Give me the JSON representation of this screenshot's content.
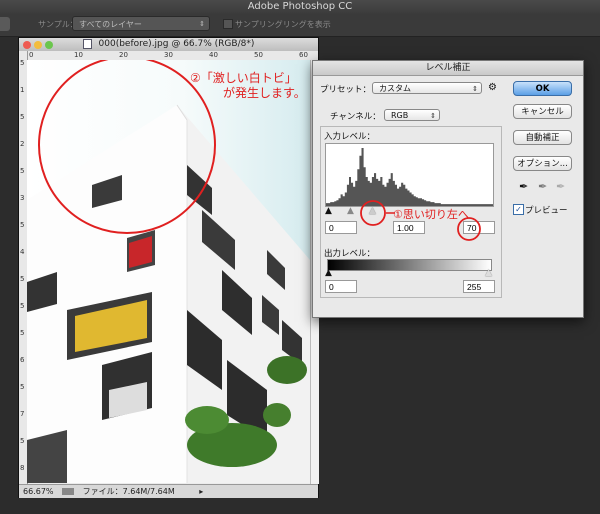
{
  "app": {
    "title": "Adobe Photoshop CC"
  },
  "options_bar": {
    "sample_label": "サンプル：",
    "layer_select": "すべてのレイヤー",
    "sampling_ring_label": "サンプリングリングを表示"
  },
  "document": {
    "title": "000(before).jpg @ 66.7% (RGB/8*)",
    "ruler_top": [
      "0",
      "10",
      "20",
      "30",
      "40",
      "50",
      "60"
    ],
    "ruler_left": [
      "5",
      "1",
      "5",
      "2",
      "5",
      "3",
      "5",
      "4",
      "5",
      "5",
      "5",
      "6",
      "5",
      "7",
      "5",
      "8"
    ],
    "zoom": "66.67%",
    "file_info": "ファイル：7.64M/7.64M"
  },
  "levels": {
    "title": "レベル補正",
    "preset_label": "プリセット：",
    "preset_value": "カスタム",
    "channel_label": "チャンネル：",
    "channel_value": "RGB",
    "input_label": "入力レベル：",
    "input_black": "0",
    "input_gamma": "1.00",
    "input_white": "70",
    "output_label": "出力レベル：",
    "output_black": "0",
    "output_white": "255",
    "ok": "OK",
    "cancel": "キャンセル",
    "auto": "自動補正",
    "options": "オプション...",
    "preview_label": "プレビュー",
    "preview_checked": true,
    "histogram": [
      3,
      3,
      4,
      4,
      5,
      6,
      8,
      12,
      10,
      14,
      22,
      30,
      24,
      20,
      26,
      38,
      52,
      60,
      40,
      30,
      26,
      24,
      30,
      34,
      28,
      26,
      30,
      22,
      20,
      24,
      28,
      34,
      26,
      22,
      18,
      20,
      24,
      22,
      18,
      16,
      14,
      12,
      10,
      9,
      8,
      8,
      7,
      6,
      5,
      5,
      4,
      4,
      3,
      3,
      3,
      2,
      2,
      2,
      2,
      2,
      2,
      2,
      2,
      2,
      2,
      2,
      2,
      2,
      2,
      2,
      2,
      2,
      2,
      2,
      2,
      2,
      2,
      2,
      2,
      2
    ]
  },
  "annotations": {
    "top_line1": "②「激しい白トビ」",
    "top_line2": "が発生します。",
    "slider_note": "①思い切り左へ"
  },
  "colors": {
    "annotation_red": "#e02020",
    "ok_blue": "#5b9fe6",
    "sky": "#d6ecef"
  }
}
